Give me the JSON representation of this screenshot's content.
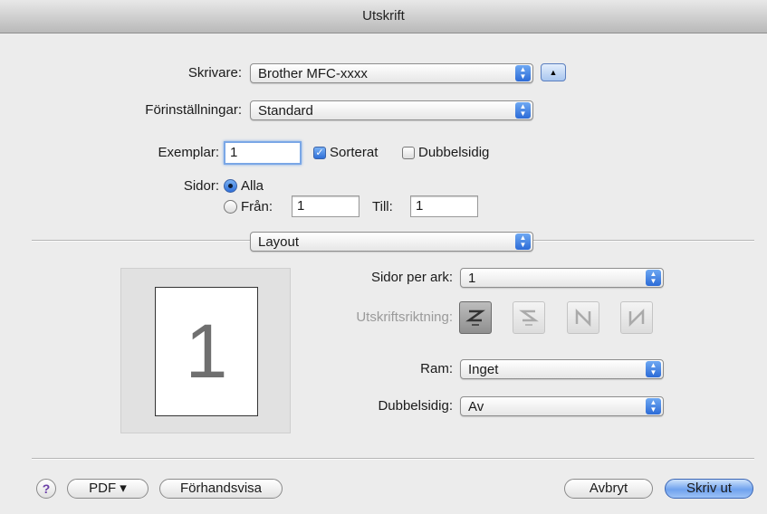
{
  "window": {
    "title": "Utskrift"
  },
  "printer": {
    "label": "Skrivare:",
    "value": "Brother MFC-xxxx"
  },
  "presets": {
    "label": "Förinställningar:",
    "value": "Standard"
  },
  "copies": {
    "label": "Exemplar:",
    "value": "1",
    "collated_label": "Sorterat",
    "collated": true,
    "duplex_label": "Dubbelsidig",
    "duplex": false
  },
  "pages": {
    "label": "Sidor:",
    "all_label": "Alla",
    "all_selected": true,
    "from_label": "Från:",
    "from_value": "1",
    "to_label": "Till:",
    "to_value": "1"
  },
  "section": {
    "value": "Layout"
  },
  "preview": {
    "page_number": "1"
  },
  "layout": {
    "pages_per_sheet_label": "Sidor per ark:",
    "pages_per_sheet": "1",
    "direction_label": "Utskriftsriktning:",
    "border_label": "Ram:",
    "border": "Inget",
    "two_sided_label": "Dubbelsidig:",
    "two_sided": "Av"
  },
  "footer": {
    "help": "?",
    "pdf": "PDF ▾",
    "preview": "Förhandsvisa",
    "cancel": "Avbryt",
    "print": "Skriv ut"
  },
  "colors": {
    "accent": "#2c6bd7",
    "default_button": "#6fa2ee"
  }
}
